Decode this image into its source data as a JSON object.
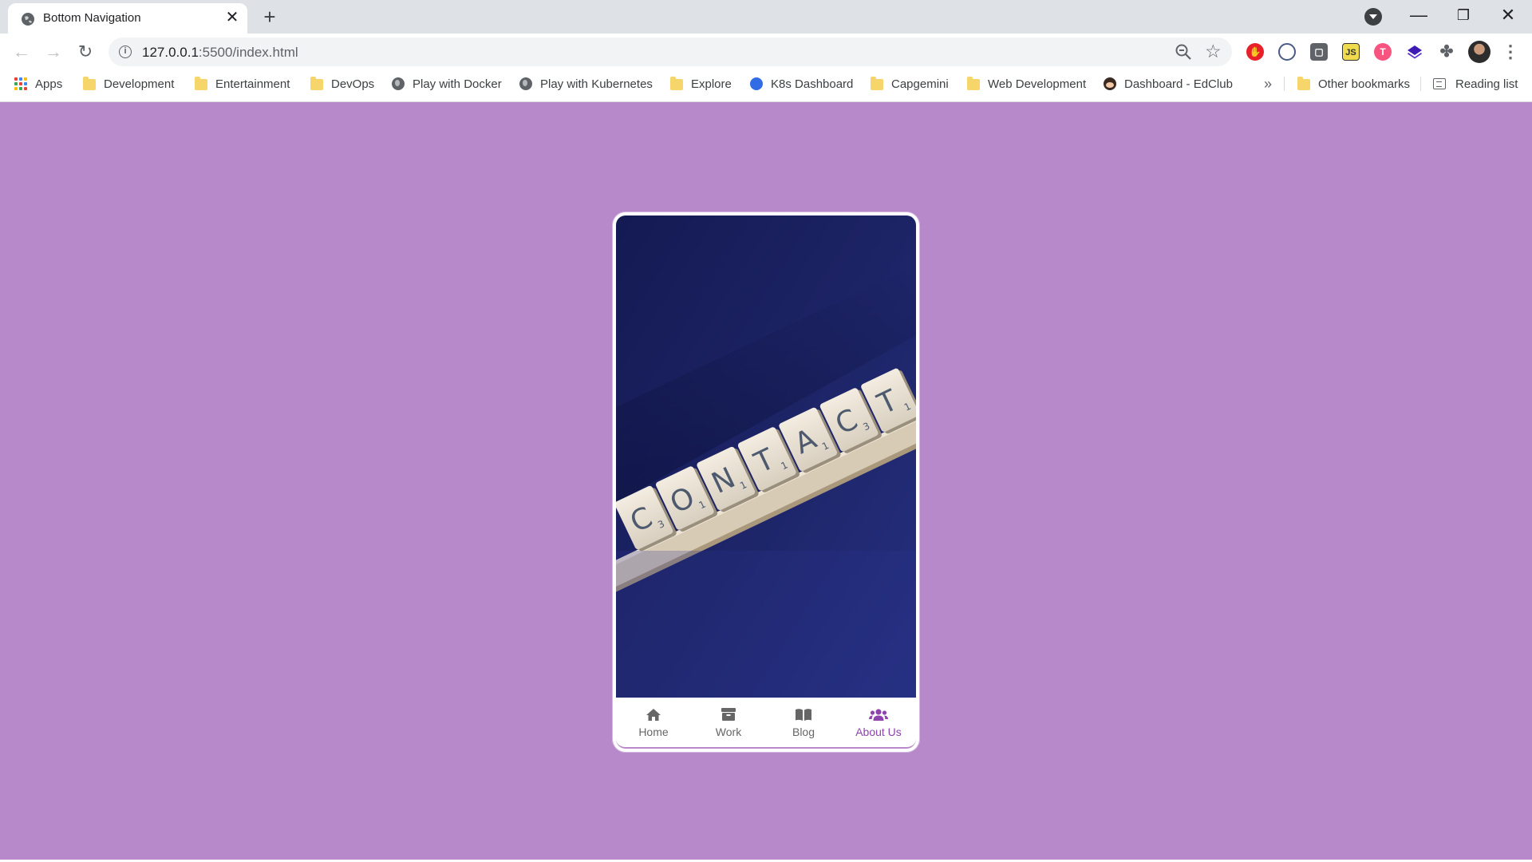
{
  "browser": {
    "tab_title": "Bottom Navigation",
    "tab_close_glyph": "✕",
    "new_tab_glyph": "+",
    "url_host": "127.0.0.1",
    "url_path": ":5500/index.html",
    "window_controls": {
      "minimize": "—",
      "maximize": "❐",
      "close": "✕"
    },
    "extensions": [
      "adblock-icon",
      "block-icon",
      "screenshot-icon",
      "js-icon",
      "tineye-icon",
      "layers-icon",
      "puzzle-icon"
    ],
    "ext_js_label": "JS",
    "ext_t_label": "T"
  },
  "bookmarks": {
    "items": [
      {
        "label": "Apps",
        "icon": "apps-grid-icon"
      },
      {
        "label": "Development",
        "icon": "folder-icon"
      },
      {
        "label": "Entertainment",
        "icon": "folder-icon"
      },
      {
        "label": "DevOps",
        "icon": "folder-icon"
      },
      {
        "label": "Play with Docker",
        "icon": "globe-icon"
      },
      {
        "label": "Play with Kubernetes",
        "icon": "globe-icon"
      },
      {
        "label": "Explore",
        "icon": "folder-icon"
      },
      {
        "label": "K8s Dashboard",
        "icon": "kubernetes-icon"
      },
      {
        "label": "Capgemini",
        "icon": "folder-icon"
      },
      {
        "label": "Web Development",
        "icon": "folder-icon"
      },
      {
        "label": "Dashboard - EdClub",
        "icon": "edclub-icon"
      }
    ],
    "more_glyph": "»",
    "other_bookmarks": "Other bookmarks",
    "reading_list": "Reading list"
  },
  "page": {
    "background_color": "#b889ca",
    "tiles": [
      "C",
      "O",
      "N",
      "T",
      "A",
      "C",
      "T"
    ],
    "tile_scores": [
      "3",
      "1",
      "1",
      "1",
      "1",
      "3",
      "1"
    ],
    "bottom_nav": [
      {
        "label": "Home",
        "icon": "home-icon",
        "active": false
      },
      {
        "label": "Work",
        "icon": "briefcase-icon",
        "active": false
      },
      {
        "label": "Blog",
        "icon": "book-icon",
        "active": false
      },
      {
        "label": "About Us",
        "icon": "users-icon",
        "active": true
      }
    ],
    "active_color": "#8e44ad",
    "inactive_color": "#666666"
  }
}
